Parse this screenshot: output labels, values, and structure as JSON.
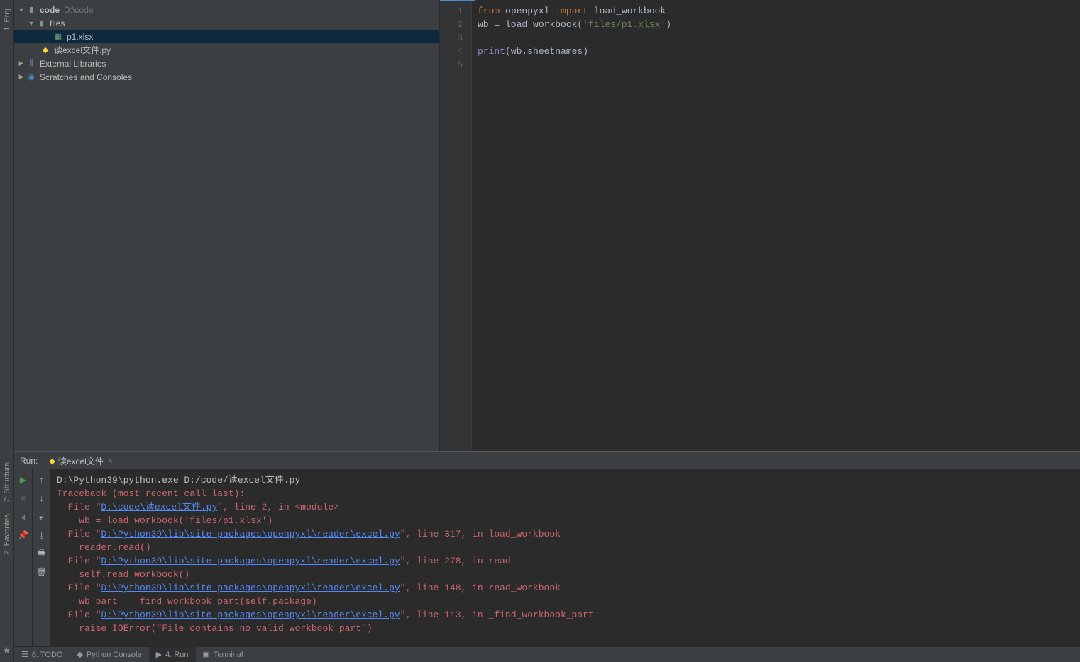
{
  "left_gutter": {
    "project_label": "1: Proj",
    "structure_label": "7: Structure",
    "favorites_label": "2: Favorites"
  },
  "tree": {
    "root_name": "code",
    "root_path": "D:\\code",
    "files_folder": "files",
    "p1_file": "p1.xlsx",
    "read_excel_py": "读excel文件.py",
    "external_libs": "External Libraries",
    "scratches": "Scratches and Consoles"
  },
  "editor": {
    "lines": {
      "l1": "1",
      "l2": "2",
      "l3": "3",
      "l4": "4",
      "l5": "5"
    },
    "code": {
      "from": "from",
      "openpyxl": " openpyxl ",
      "import": "import",
      "load_workbook": " load_workbook",
      "wb_eq": "wb = load_workbook(",
      "str_open": "'files/p1.",
      "xlsx_u": "xlsx",
      "str_close": "'",
      "paren_close": ")",
      "print": "print",
      "print_args": "(wb.sheetnames)"
    }
  },
  "run": {
    "title": "Run:",
    "tab_name": "读excel文件",
    "cmd": "D:\\Python39\\python.exe D:/code/读excel文件.py",
    "traceback": "Traceback (most recent call last):",
    "file_pre": "  File \"",
    "link1": "D:\\code\\读excel文件.py",
    "line1_post": "\", line 2, in <module>",
    "code1": "    wb = load_workbook('files/p1.xlsx')",
    "link2": "D:\\Python39\\lib\\site-packages\\openpyxl\\reader\\excel.py",
    "line2_post": "\", line 317, in load_workbook",
    "code2": "    reader.read()",
    "line3_post": "\", line 278, in read",
    "code3": "    self.read_workbook()",
    "line4_post": "\", line 148, in read_workbook",
    "code4": "    wb_part = _find_workbook_part(self.package)",
    "line5_post": "\", line 113, in _find_workbook_part",
    "code5": "    raise IOError(\"File contains no valid workbook part\")"
  },
  "bottom": {
    "todo": "6: TODO",
    "python_console": "Python Console",
    "run": "4: Run",
    "terminal": "Terminal"
  }
}
